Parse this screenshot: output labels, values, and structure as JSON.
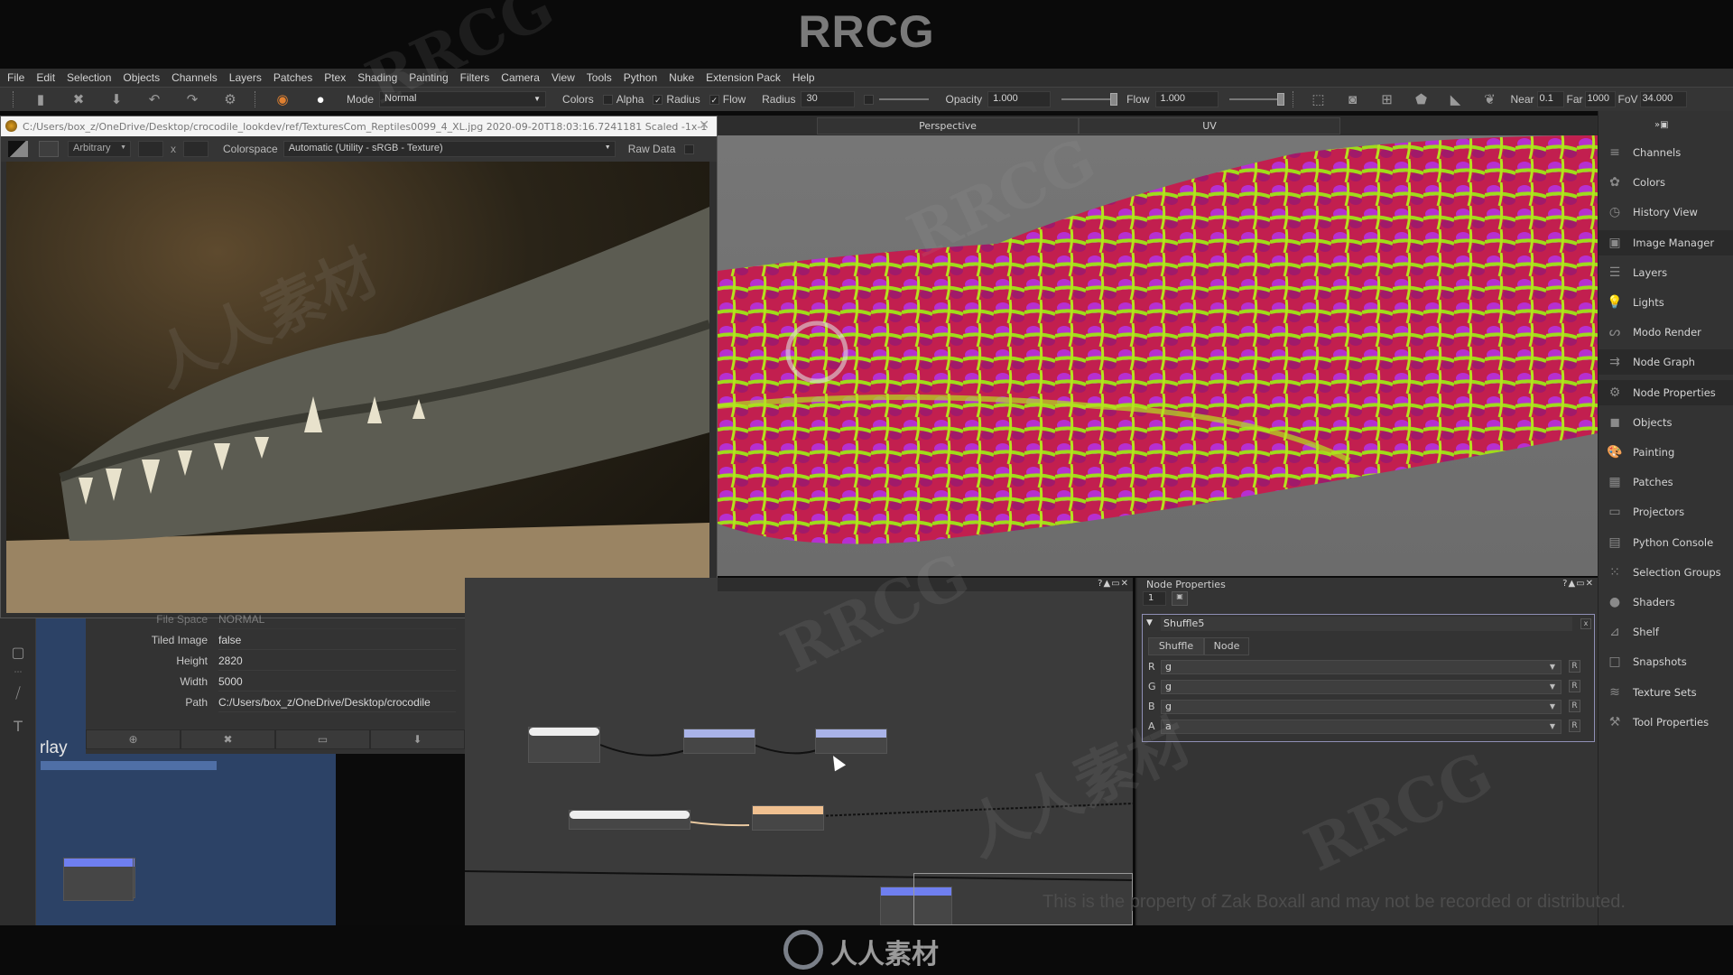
{
  "overlay_brand": "RRCG",
  "menubar": {
    "items": [
      "File",
      "Edit",
      "Selection",
      "Objects",
      "Channels",
      "Layers",
      "Patches",
      "Ptex",
      "Shading",
      "Painting",
      "Filters",
      "Camera",
      "View",
      "Tools",
      "Python",
      "Nuke",
      "Extension Pack",
      "Help"
    ]
  },
  "toolbar": {
    "icons": [
      "new-file-icon",
      "close-file-icon",
      "save-file-icon",
      "undo-icon",
      "redo-icon",
      "project-settings-icon"
    ],
    "mode_label": "Mode",
    "mode_value": "Normal",
    "colors_label": "Colors",
    "alpha_label": "Alpha",
    "alpha_checked": false,
    "radius_check_label": "Radius",
    "radius_checked": true,
    "flow_check_label": "Flow",
    "flow_checked": true,
    "radius_label": "Radius",
    "radius_value": "30",
    "opacity_label": "Opacity",
    "opacity_value": "1.000",
    "opacity_slider": 1.0,
    "flow_label": "Flow",
    "flow_value": "1.000",
    "flow_slider": 1.0,
    "near_label": "Near",
    "near_value": "0.1",
    "far_label": "Far",
    "far_value": "1000",
    "fov_label": "FoV",
    "fov_value": "34.000"
  },
  "image_window": {
    "title": "C:/Users/box_z/OneDrive/Desktop/crocodile_lookdev/ref/TexturesCom_Reptiles0099_4_XL.jpg 2020-09-20T18:03:16.7241181 Scaled -1x-1",
    "size_mode": "Arbitrary",
    "size_x": "",
    "size_y": "",
    "size_sep": "x",
    "colorspace_label": "Colorspace",
    "colorspace_value": "Automatic (Utility - sRGB - Texture)",
    "raw_data_label": "Raw Data"
  },
  "viewport": {
    "tabs": [
      "Perspective",
      "UV"
    ]
  },
  "properties": {
    "rows": [
      {
        "label": "File Space",
        "value": "NORMAL"
      },
      {
        "label": "Tiled Image",
        "value": "false"
      },
      {
        "label": "Height",
        "value": "2820"
      },
      {
        "label": "Width",
        "value": "5000"
      },
      {
        "label": "Path",
        "value": "C:/Users/box_z/OneDrive/Desktop/crocodile"
      }
    ]
  },
  "overlay_panel": {
    "label": "rlay"
  },
  "node_properties": {
    "title": "Node Properties",
    "page_value": "1",
    "node_name": "Shuffle5",
    "tabs": [
      "Shuffle",
      "Node"
    ],
    "active_tab": "Shuffle",
    "channels": [
      {
        "channel": "R",
        "value": "g",
        "reset": "R"
      },
      {
        "channel": "G",
        "value": "g",
        "reset": "R"
      },
      {
        "channel": "B",
        "value": "g",
        "reset": "R"
      },
      {
        "channel": "A",
        "value": "a",
        "reset": "R"
      }
    ],
    "panel_controls": "?▲▭✕"
  },
  "right_dock": {
    "items": [
      {
        "label": "Channels",
        "icon": "≡"
      },
      {
        "label": "Colors",
        "icon": "✿"
      },
      {
        "label": "History View",
        "icon": "◷"
      },
      {
        "label": "Image Manager",
        "icon": "▣"
      },
      {
        "label": "Layers",
        "icon": "☰"
      },
      {
        "label": "Lights",
        "icon": "💡"
      },
      {
        "label": "Modo Render",
        "icon": "ᔕ"
      },
      {
        "label": "Node Graph",
        "icon": "⇉"
      },
      {
        "label": "Node Properties",
        "icon": "⚙"
      },
      {
        "label": "Objects",
        "icon": "◼"
      },
      {
        "label": "Painting",
        "icon": "🎨"
      },
      {
        "label": "Patches",
        "icon": "▦"
      },
      {
        "label": "Projectors",
        "icon": "▭"
      },
      {
        "label": "Python Console",
        "icon": "▤"
      },
      {
        "label": "Selection Groups",
        "icon": "⁙"
      },
      {
        "label": "Shaders",
        "icon": "●"
      },
      {
        "label": "Shelf",
        "icon": "⊿"
      },
      {
        "label": "Snapshots",
        "icon": "□"
      },
      {
        "label": "Texture Sets",
        "icon": "≋"
      },
      {
        "label": "Tool Properties",
        "icon": "⚒"
      }
    ]
  },
  "disclaimer": "This is the property of Zak Boxall and may not be recorded or distributed.",
  "footer_brand": "人人素材",
  "watermarks": [
    "RRCG",
    "人人素材"
  ]
}
